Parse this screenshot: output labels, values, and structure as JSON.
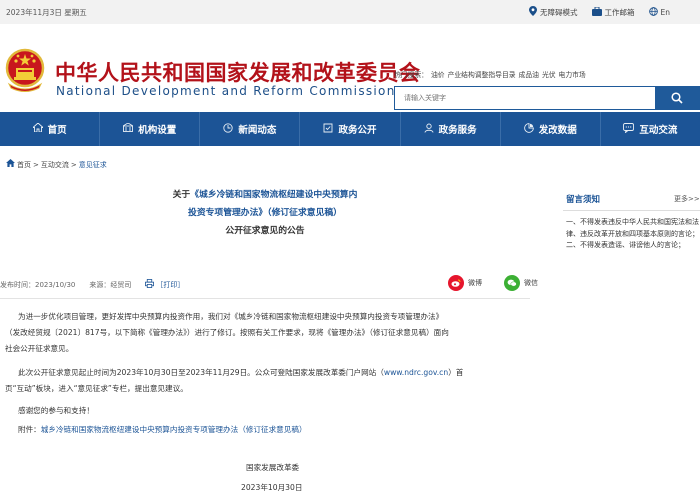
{
  "topbar": {
    "date": "2023年11月3日 星期五",
    "accessibility": "无障碍模式",
    "webmail": "工作邮箱",
    "lang": "En"
  },
  "header": {
    "title_cn": "中华人民共和国国家发展和改革委员会",
    "title_en": "National Development and Reform Commission",
    "hot_label": "热门搜索：",
    "hot_terms": [
      "油价",
      "产业结构调整指导目录",
      "成品油",
      "光伏",
      "电力市场"
    ],
    "search_placeholder": "请输入关键字"
  },
  "nav": {
    "items": [
      {
        "label": "首页",
        "icon": "home-icon"
      },
      {
        "label": "机构设置",
        "icon": "building-icon"
      },
      {
        "label": "新闻动态",
        "icon": "news-icon"
      },
      {
        "label": "政务公开",
        "icon": "gov-icon"
      },
      {
        "label": "政务服务",
        "icon": "service-icon"
      },
      {
        "label": "发改数据",
        "icon": "data-icon"
      },
      {
        "label": "互动交流",
        "icon": "chat-icon"
      }
    ]
  },
  "breadcrumb": {
    "home": "首页",
    "sep": ">",
    "level1": "互动交流",
    "current": "意见征求"
  },
  "article": {
    "title_line1_prefix": "关于",
    "title_line1_blue": "《城乡冷链和国家物流枢纽建设中央预算内",
    "title_line2": "投资专项管理办法》（修订征求意见稿）",
    "title_line3": "公开征求意见的公告",
    "publish_time": "发布时间：2023/10/30",
    "source": "来源：经贸司",
    "print": "［打印］",
    "share_weibo": "微博",
    "share_wechat": "微信",
    "p1_l1": "为进一步优化项目管理，更好发挥中央预算内投资作用，我们对《城乡冷链和国家物流枢纽建设中央预算内投资专项管理办法》",
    "p1_l2": "（发改经贸规〔2021〕817号，以下简称《管理办法》）进行了修订。按照有关工作要求，现将《管理办法》（修订征求意见稿）面向",
    "p1_l3": "社会公开征求意见。",
    "p2_l1_a": "此次公开征求意见起止时间为2023年10月30日至2023年11月29日。公众可登陆国家发展改革委门户网站（",
    "p2_link": "www.ndrc.gov.cn",
    "p2_l1_b": "）首",
    "p2_l2": "页“互动”板块，进入“意见征求”专栏，提出意见建议。",
    "p3": "感谢您的参与和支持！",
    "attach_label": "附件：",
    "attach_link": "城乡冷链和国家物流枢纽建设中央预算内投资专项管理办法（修订征求意见稿）",
    "sign_org": "国家发展改革委",
    "sign_date": "2023年10月30日"
  },
  "sidebar": {
    "title": "留言须知",
    "more": "更多>>",
    "rule1": "一、不得发表违反中华人民共和国宪法和法律、违反改革开放和四项基本原则的言论；",
    "rule2": "二、不得发表造谣、诽谤他人的言论；"
  },
  "colors": {
    "brand_blue": "#1c5496",
    "title_red": "#b3121a",
    "weibo_red": "#e6162d",
    "wechat_green": "#3cb034"
  }
}
